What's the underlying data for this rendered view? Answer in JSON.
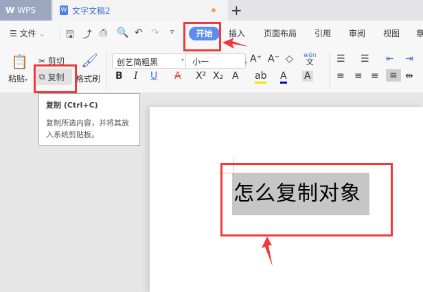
{
  "tabs": {
    "app": "WPS",
    "doc": "文字文稿2",
    "new_tab": "+"
  },
  "menu": {
    "file": "文件",
    "items": [
      "开始",
      "插入",
      "页面布局",
      "引用",
      "审阅",
      "视图",
      "章"
    ]
  },
  "ribbon": {
    "paste": "粘贴",
    "cut": "剪切",
    "copy": "复制",
    "format_painter": "格式刷",
    "font": "创艺简粗黑",
    "size": "小一",
    "pinyin": "wén"
  },
  "tooltip": {
    "title": "复制 (Ctrl+C)",
    "desc": "复制所选内容，并将其放入系统剪贴板。"
  },
  "document": {
    "selected_text": "怎么复制对象"
  },
  "colors": {
    "accent": "#5b8def",
    "annotation": "#f0393a"
  }
}
